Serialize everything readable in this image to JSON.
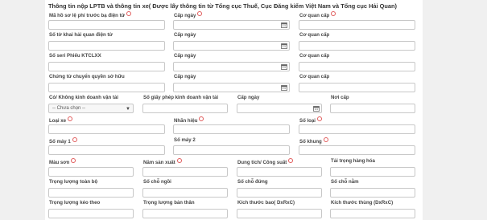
{
  "section": {
    "title": "Thông tin nộp LPTB và thông tin xe( Được lấy thông tin từ Tổng cục Thuế, Cục Đăng kiểm Việt Nam và Tổng cục Hải Quan)"
  },
  "fields": {
    "ma_ho_so_label": "Mã hồ sơ lệ phí trước bạ điện tử",
    "cap_ngay_1_label": "Cấp ngày",
    "co_quan_cap_1_label": "Cơ quan cấp",
    "so_to_khai_label": "Số tờ khai hải quan điện tử",
    "cap_ngay_2_label": "Cấp ngày",
    "co_quan_cap_2_label": "Cơ quan cấp",
    "so_seri_label": "Số seri Phiếu KTCLXX",
    "cap_ngay_3_label": "Cấp ngày",
    "co_quan_cap_3_label": "Cơ quan cấp",
    "chung_tu_label": "Chứng từ chuyển quyền sở hữu",
    "cap_ngay_4_label": "Cấp ngày",
    "co_quan_cap_4_label": "Cơ quan cấp",
    "kinh_doanh_label": "Có/ Không kinh doanh vận tải",
    "kinh_doanh_value": "-- Chưa chọn --",
    "giay_phep_label": "Số giấy phép kinh doanh vận tải",
    "cap_ngay_5_label": "Cấp ngày",
    "noi_cap_label": "Nơi cấp",
    "loai_xe_label": "Loại xe",
    "nhan_hieu_label": "Nhãn hiệu",
    "so_loai_label": "Số loại",
    "so_may_1_label": "Số máy 1",
    "so_may_2_label": "Số máy 2",
    "so_khung_label": "Số khung",
    "mau_son_label": "Màu sơn",
    "nam_san_xuat_label": "Năm sản xuất",
    "dung_tich_label": "Dung tích/ Công suất",
    "tai_trong_label": "Tải trọng hàng hóa",
    "trong_luong_toan_bo_label": "Trọng lượng toàn bộ",
    "so_cho_ngoi_label": "Số chỗ ngồi",
    "so_cho_dung_label": "Số chỗ đứng",
    "so_cho_nam_label": "Số chỗ nằm",
    "trong_luong_keo_theo_label": "Trọng lượng kéo theo",
    "trong_luong_ban_than_label": "Trọng lượng bản thân",
    "kich_thuoc_bao_label": "Kích thước bao( DxRxC)",
    "kich_thuoc_thung_label": "Kích thước thùng (DxRxC)"
  },
  "colors": {
    "required": "#e05a5a",
    "border": "#c8c8c8",
    "background": "#f0f0f0"
  },
  "icons": {
    "date": "calendar-icon",
    "select": "chevron-down-icon",
    "required": "required-circle-icon"
  }
}
